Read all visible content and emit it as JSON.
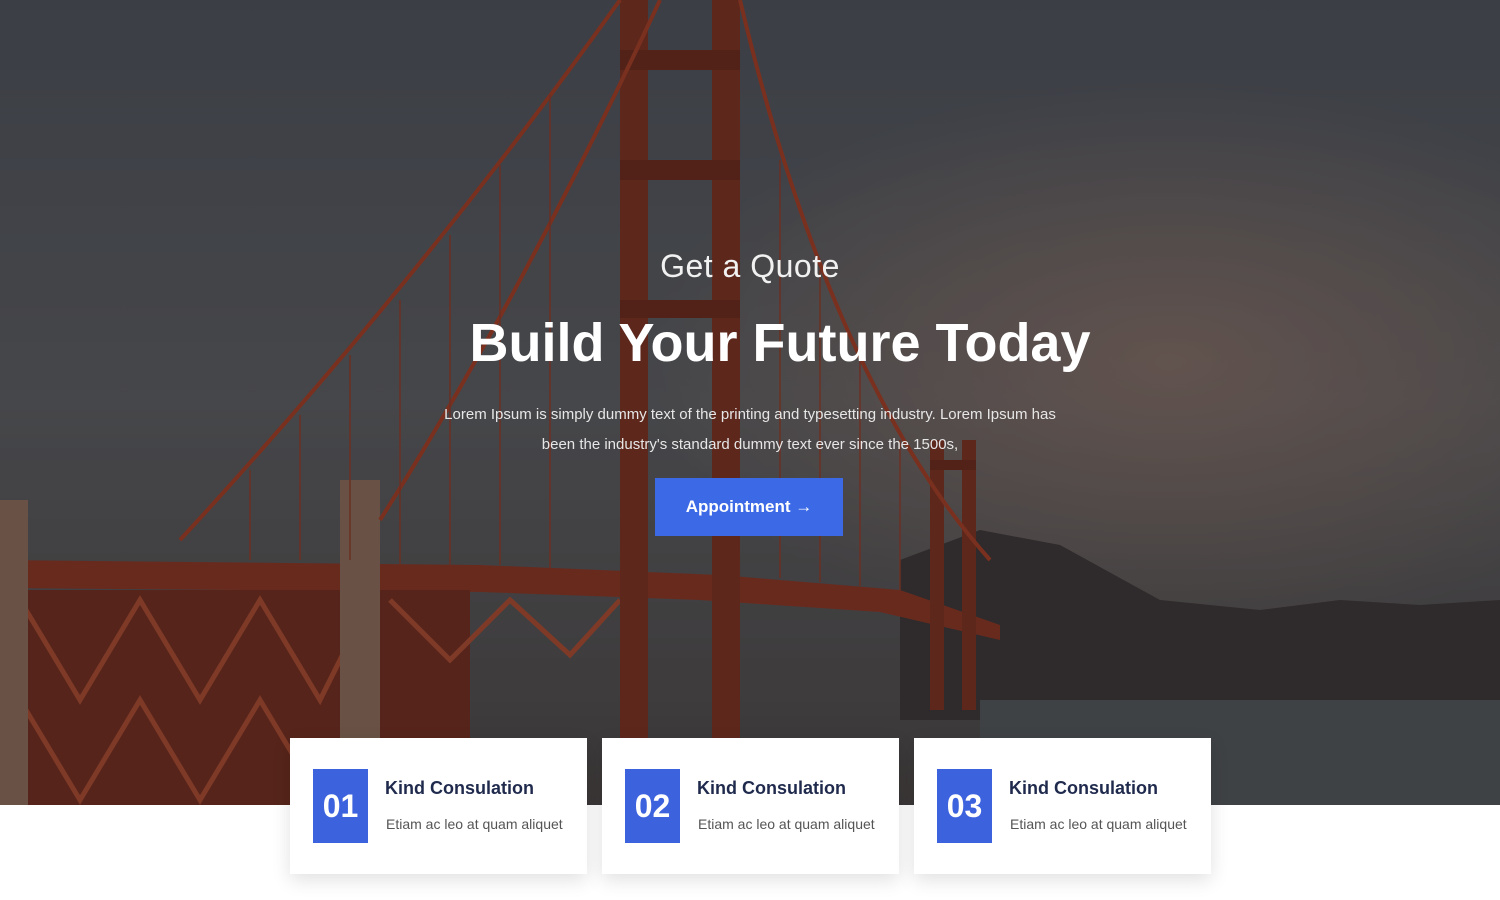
{
  "hero": {
    "eyebrow": "Get a Quote",
    "headline": "Build Your Future Today",
    "lead": "Lorem Ipsum is simply dummy text of the printing and typesetting industry. Lorem Ipsum has been the industry's standard dummy text ever since the 1500s,",
    "cta_label": "Appointment →"
  },
  "cards": [
    {
      "number": "01",
      "title": "Kind Consulation",
      "desc": "Etiam ac leo at quam aliquet"
    },
    {
      "number": "02",
      "title": "Kind Consulation",
      "desc": "Etiam ac leo at quam aliquet"
    },
    {
      "number": "03",
      "title": "Kind Consulation",
      "desc": "Etiam ac leo at quam aliquet"
    }
  ],
  "colors": {
    "accent": "#3c6ae6",
    "number_box": "#3c62de",
    "card_title": "#1f2a4d",
    "bridge": "#9c3a22"
  },
  "icons": {
    "cta_arrow": "arrow-right-icon"
  }
}
